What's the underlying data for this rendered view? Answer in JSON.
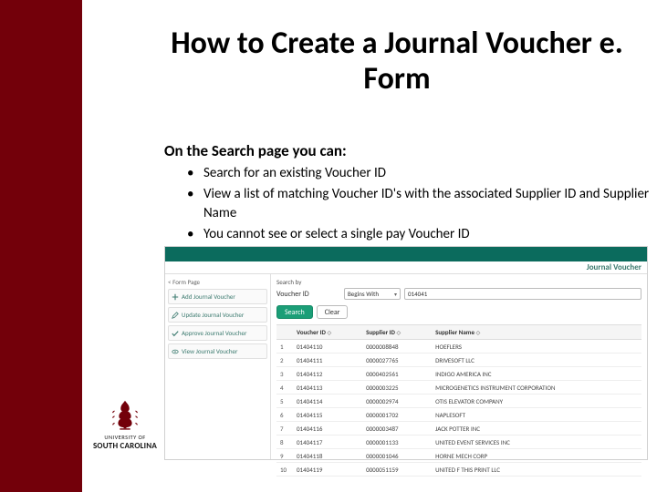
{
  "title": "How to Create a Journal Voucher e. Form",
  "subtitle": "On the Search page you can:",
  "bullets": [
    "Search for an existing Voucher ID",
    "View a list of matching Voucher ID's with the associated Supplier ID and Supplier Name",
    "You cannot see or select a single pay Voucher ID"
  ],
  "logo": {
    "university_of": "UNIVERSITY OF",
    "sc": "SOUTH CAROLINA"
  },
  "screenshot": {
    "header": "Journal Voucher",
    "left_title": "< Form Page",
    "nav": [
      {
        "icon": "plus",
        "label": "Add Journal Voucher"
      },
      {
        "icon": "pencil",
        "label": "Update Journal Voucher"
      },
      {
        "icon": "check",
        "label": "Approve Journal Voucher"
      },
      {
        "icon": "eye",
        "label": "View Journal Voucher"
      }
    ],
    "search_by": "Search by",
    "field_label": "Voucher ID",
    "operator": "Begins With",
    "value": "014041",
    "btn_search": "Search",
    "btn_clear": "Clear",
    "columns": [
      "Voucher ID",
      "Supplier ID",
      "Supplier Name"
    ],
    "rows": [
      {
        "n": "1",
        "vid": "01404110",
        "sid": "0000008848",
        "sname": "HOEFLERS"
      },
      {
        "n": "2",
        "vid": "01404111",
        "sid": "0000027765",
        "sname": "DRIVESOFT LLC"
      },
      {
        "n": "3",
        "vid": "01404112",
        "sid": "0000402561",
        "sname": "INDIGO AMERICA INC"
      },
      {
        "n": "4",
        "vid": "01404113",
        "sid": "0000003225",
        "sname": "MICROGENETICS INSTRUMENT CORPORATION"
      },
      {
        "n": "5",
        "vid": "01404114",
        "sid": "0000002974",
        "sname": "OTIS ELEVATOR COMPANY"
      },
      {
        "n": "6",
        "vid": "01404115",
        "sid": "0000001702",
        "sname": "NAPLESOFT"
      },
      {
        "n": "7",
        "vid": "01404116",
        "sid": "0000003487",
        "sname": "JACK POTTER INC"
      },
      {
        "n": "8",
        "vid": "01404117",
        "sid": "0000001133",
        "sname": "UNITED EVENT SERVICES INC"
      },
      {
        "n": "9",
        "vid": "01404118",
        "sid": "0000001046",
        "sname": "HORNE MECH CORP"
      },
      {
        "n": "10",
        "vid": "01404119",
        "sid": "0000051159",
        "sname": "UNITED F THIS PRINT LLC"
      }
    ]
  }
}
